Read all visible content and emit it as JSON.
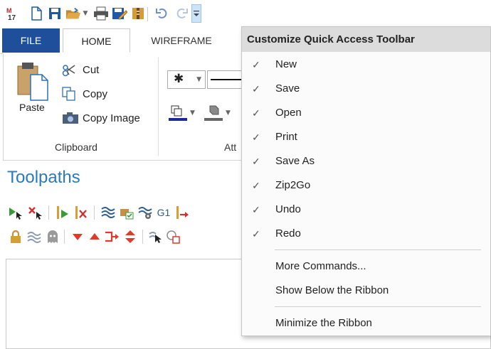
{
  "app": {
    "logo_text": "17"
  },
  "ribbon": {
    "tabs": [
      {
        "label": "FILE"
      },
      {
        "label": "HOME"
      },
      {
        "label": "WIREFRAME"
      }
    ],
    "clipboard": {
      "paste_label": "Paste",
      "cut_label": "Cut",
      "copy_label": "Copy",
      "copy_image_label": "Copy Image",
      "group_label": "Clipboard"
    },
    "attributes": {
      "group_label_partial": "Att"
    }
  },
  "toolpaths": {
    "title": "Toolpaths",
    "g1_label": "G1"
  },
  "menu": {
    "title": "Customize Quick Access Toolbar",
    "items": [
      {
        "label": "New",
        "checked": "✓"
      },
      {
        "label": "Save",
        "checked": "✓"
      },
      {
        "label": "Open",
        "checked": "✓"
      },
      {
        "label": "Print",
        "checked": "✓"
      },
      {
        "label": "Save As",
        "checked": "✓"
      },
      {
        "label": "Zip2Go",
        "checked": "✓"
      },
      {
        "label": "Undo",
        "checked": "✓"
      },
      {
        "label": "Redo",
        "checked": "✓"
      }
    ],
    "more_commands": "More Commands...",
    "show_below": "Show Below the Ribbon",
    "minimize": "Minimize the Ribbon"
  },
  "colors": {
    "accent": "#1f4e9a",
    "toolpaths_title": "#2a7abf",
    "menu_header_bg": "#dcdcdc"
  }
}
